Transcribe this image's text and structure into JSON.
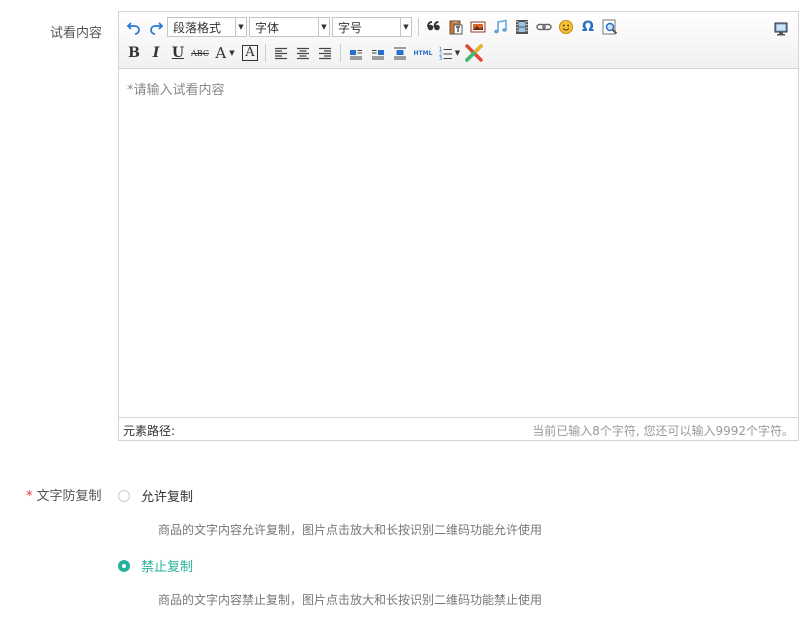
{
  "labels": {
    "preview_content": "试看内容",
    "text_copy_protection": "文字防复制",
    "required_mark": "*"
  },
  "editor": {
    "toolbar": {
      "paragraph_combo": "段落格式",
      "font_combo": "字体",
      "size_combo": "字号",
      "bold": "B",
      "italic": "I",
      "underline": "U",
      "strikethrough": "ABC",
      "font_color": "A",
      "bg_color": "A",
      "html": "HTML"
    },
    "placeholder": "*请输入试看内容",
    "status_path": "元素路径:",
    "char_count": "当前已输入8个字符, 您还可以输入9992个字符。"
  },
  "copy_options": [
    {
      "label": "允许复制",
      "checked": false,
      "desc": "商品的文字内容允许复制，图片点击放大和长按识别二维码功能允许使用"
    },
    {
      "label": "禁止复制",
      "checked": true,
      "desc": "商品的文字内容禁止复制，图片点击放大和长按识别二维码功能禁止使用"
    }
  ],
  "colors": {
    "accent": "#26b29a",
    "required": "#e4393c"
  }
}
